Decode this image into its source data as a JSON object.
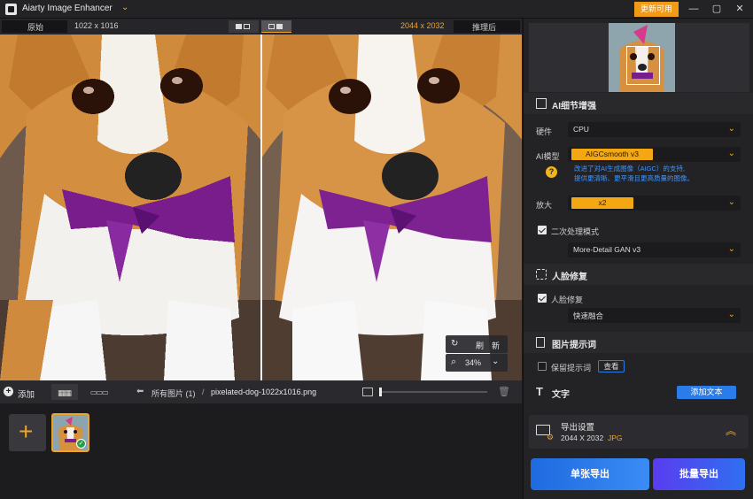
{
  "app": {
    "title": "Aiarty Image Enhancer",
    "update_label": "更新可用"
  },
  "window": {
    "minimize": "—",
    "restore": "▢",
    "close": "✕"
  },
  "compare": {
    "left_label": "原始",
    "left_size": "1022 x 1016",
    "right_size": "2044 x 2032",
    "right_label": "推理后"
  },
  "overlay": {
    "refresh_label": "刷　新",
    "zoom": "34%"
  },
  "bottom_bar": {
    "add_label": "添加",
    "path_root": "所有图片 (1)",
    "path_sep": "/",
    "filename": "pixelated-dog-1022x1016.png"
  },
  "right_panel": {
    "ai_section": {
      "title": "AI细节增强",
      "hardware_label": "硬件",
      "hardware_value": "CPU",
      "model_label": "AI模型",
      "model_value": "AIGCsmooth  v3",
      "model_desc_line1": "改进了对AI生成图像（AIGC）的支持,",
      "model_desc_line2": "提供更清晰、更平滑且更高质量的图像。",
      "scale_label": "放大",
      "scale_value": "x2",
      "secondary_label": "二次处理模式",
      "secondary_value": "More-Detail GAN  v3"
    },
    "face_section": {
      "title": "人脸修复",
      "checkbox_label": "人脸修复",
      "mode_value": "快速融合"
    },
    "prompt_section": {
      "title": "图片提示词",
      "keep_label": "保留提示词",
      "view_button": "查看"
    },
    "text_section": {
      "title": "文字",
      "add_button": "添加文本"
    },
    "export": {
      "title": "导出设置",
      "size": "2044 X 2032",
      "format": "JPG",
      "single_button": "单张导出",
      "batch_button": "批量导出"
    }
  },
  "colors": {
    "accent": "#f0a424",
    "brand_blue": "#2a7ce8"
  }
}
